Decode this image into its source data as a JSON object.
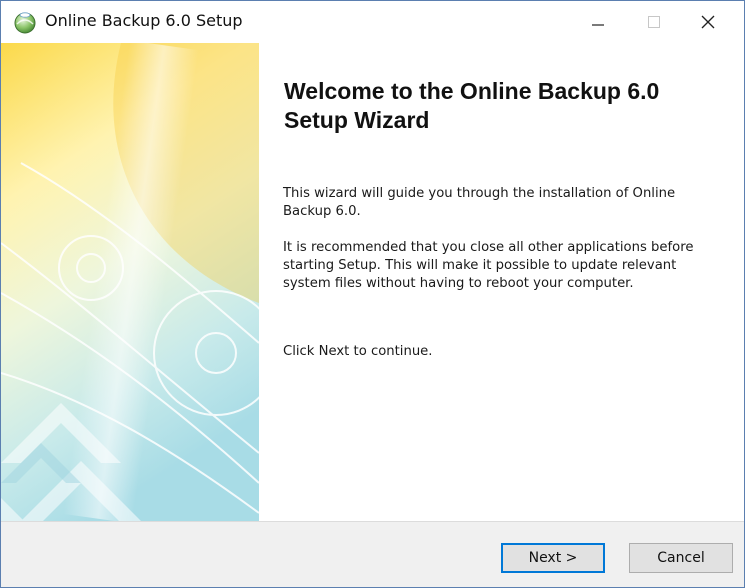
{
  "window": {
    "title": "Online Backup 6.0 Setup",
    "controls": {
      "minimize_icon": "minimize-icon",
      "maximize_icon": "maximize-icon",
      "close_icon": "close-icon"
    }
  },
  "sidebar": {
    "image": "wizard-banner-image",
    "colors": [
      "#fbd94a",
      "#fff7c2",
      "#dff0e2",
      "#bfe6ea",
      "#9fd6e3"
    ]
  },
  "content": {
    "heading": "Welcome to the Online Backup 6.0 Setup Wizard",
    "paragraphs": [
      "This wizard will guide you through the installation of Online Backup 6.0.",
      "It is recommended that you close all other applications before starting Setup. This will make it possible to update relevant system files without having to reboot your computer.",
      "Click Next to continue."
    ]
  },
  "footer": {
    "next_label": "Next >",
    "cancel_label": "Cancel"
  },
  "colors": {
    "accent": "#0078d7",
    "window_border": "#5b7fb0",
    "footer_bg": "#f0f0f0"
  }
}
